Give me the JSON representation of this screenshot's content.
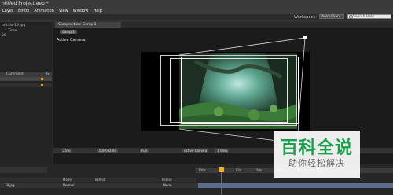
{
  "app": {
    "title": "ntitled Project.aep *"
  },
  "menu": [
    "Layer",
    "Effect",
    "Animation",
    "View",
    "Window",
    "Help"
  ],
  "workspace": {
    "label": "Workspace:",
    "value": "Animation"
  },
  "search": {
    "placeholder": "Search Help"
  },
  "project_panel": {
    "file_name": "untitlo-19.jpg",
    "info1": "1 Time",
    "info2": "00",
    "col_comment": "Comment",
    "col_type": "Ty"
  },
  "composition": {
    "tab_label": "Composition: Comp 1",
    "pill_label": "Comp 1",
    "view_label": "Active Camera"
  },
  "comp_toolbar": {
    "zoom": "25%",
    "timecode": "0;00;02;09",
    "quality": "Full",
    "camera": "Active Camera",
    "view": "1 View"
  },
  "timeline": {
    "ruler_ticks": [
      "100s",
      "02s",
      "04s",
      "06s",
      "08s",
      "10s"
    ],
    "col_mode": "Mode",
    "col_trkmat": "TrkMat",
    "col_parent": "Parent",
    "layer_name": "19.jpg",
    "layer_mode": "Normal",
    "layer_parent": "None"
  },
  "watermark": {
    "title": "百科全说",
    "subtitle": "助你轻松解决"
  }
}
